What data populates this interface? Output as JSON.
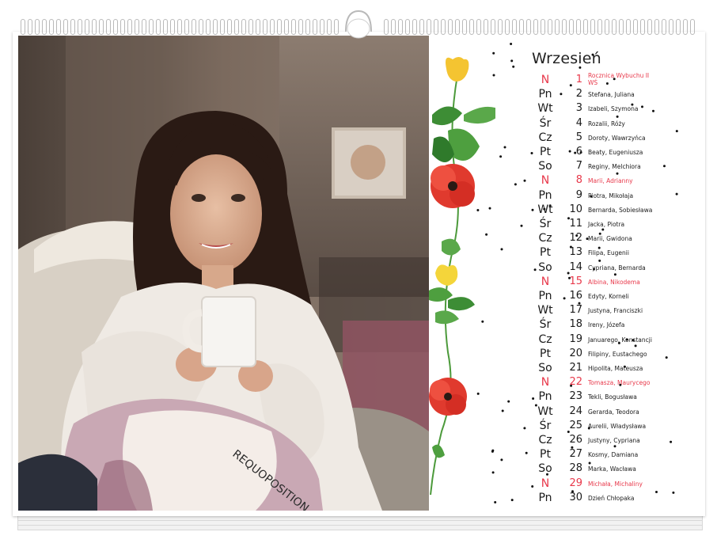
{
  "calendar": {
    "month": "Wrzesień",
    "days": [
      {
        "dow": "N",
        "day": "1",
        "names": "Rocznica Wybuchu II WŚ",
        "holiday": true
      },
      {
        "dow": "Pn",
        "day": "2",
        "names": "Stefana, Juliana",
        "holiday": false
      },
      {
        "dow": "Wt",
        "day": "3",
        "names": "Izabeli, Szymona",
        "holiday": false
      },
      {
        "dow": "Śr",
        "day": "4",
        "names": "Rozalii, Róży",
        "holiday": false
      },
      {
        "dow": "Cz",
        "day": "5",
        "names": "Doroty, Wawrzyńca",
        "holiday": false
      },
      {
        "dow": "Pt",
        "day": "6",
        "names": "Beaty, Eugeniusza",
        "holiday": false
      },
      {
        "dow": "So",
        "day": "7",
        "names": "Reginy, Melchiora",
        "holiday": false
      },
      {
        "dow": "N",
        "day": "8",
        "names": "Marii, Adrianny",
        "holiday": true
      },
      {
        "dow": "Pn",
        "day": "9",
        "names": "Piotra, Mikołaja",
        "holiday": false
      },
      {
        "dow": "Wt",
        "day": "10",
        "names": "Bernarda, Sobiesława",
        "holiday": false
      },
      {
        "dow": "Śr",
        "day": "11",
        "names": "Jacka, Piotra",
        "holiday": false
      },
      {
        "dow": "Cz",
        "day": "12",
        "names": "Marii, Gwidona",
        "holiday": false
      },
      {
        "dow": "Pt",
        "day": "13",
        "names": "Filipa, Eugenii",
        "holiday": false
      },
      {
        "dow": "So",
        "day": "14",
        "names": "Cypriana, Bernarda",
        "holiday": false
      },
      {
        "dow": "N",
        "day": "15",
        "names": "Albina, Nikodema",
        "holiday": true
      },
      {
        "dow": "Pn",
        "day": "16",
        "names": "Edyty, Korneli",
        "holiday": false
      },
      {
        "dow": "Wt",
        "day": "17",
        "names": "Justyna, Franciszki",
        "holiday": false
      },
      {
        "dow": "Śr",
        "day": "18",
        "names": "Ireny, Józefa",
        "holiday": false
      },
      {
        "dow": "Cz",
        "day": "19",
        "names": "Januarego, Konstancji",
        "holiday": false
      },
      {
        "dow": "Pt",
        "day": "20",
        "names": "Filipiny, Eustachego",
        "holiday": false
      },
      {
        "dow": "So",
        "day": "21",
        "names": "Hipolita, Mateusza",
        "holiday": false
      },
      {
        "dow": "N",
        "day": "22",
        "names": "Tomasza, Maurycego",
        "holiday": true
      },
      {
        "dow": "Pn",
        "day": "23",
        "names": "Tekli, Bogusława",
        "holiday": false
      },
      {
        "dow": "Wt",
        "day": "24",
        "names": "Gerarda, Teodora",
        "holiday": false
      },
      {
        "dow": "Śr",
        "day": "25",
        "names": "Aurelii, Władysława",
        "holiday": false
      },
      {
        "dow": "Cz",
        "day": "26",
        "names": "Justyny, Cypriana",
        "holiday": false
      },
      {
        "dow": "Pt",
        "day": "27",
        "names": "Kosmy, Damiana",
        "holiday": false
      },
      {
        "dow": "So",
        "day": "28",
        "names": "Marka, Wacława",
        "holiday": false
      },
      {
        "dow": "N",
        "day": "29",
        "names": "Michała, Michaliny",
        "holiday": true
      },
      {
        "dow": "Pn",
        "day": "30",
        "names": "Dzień Chłopaka",
        "holiday": false
      }
    ]
  },
  "colors": {
    "holiday": "#e8394b",
    "text": "#1a1a1a",
    "dot": "#111111"
  }
}
